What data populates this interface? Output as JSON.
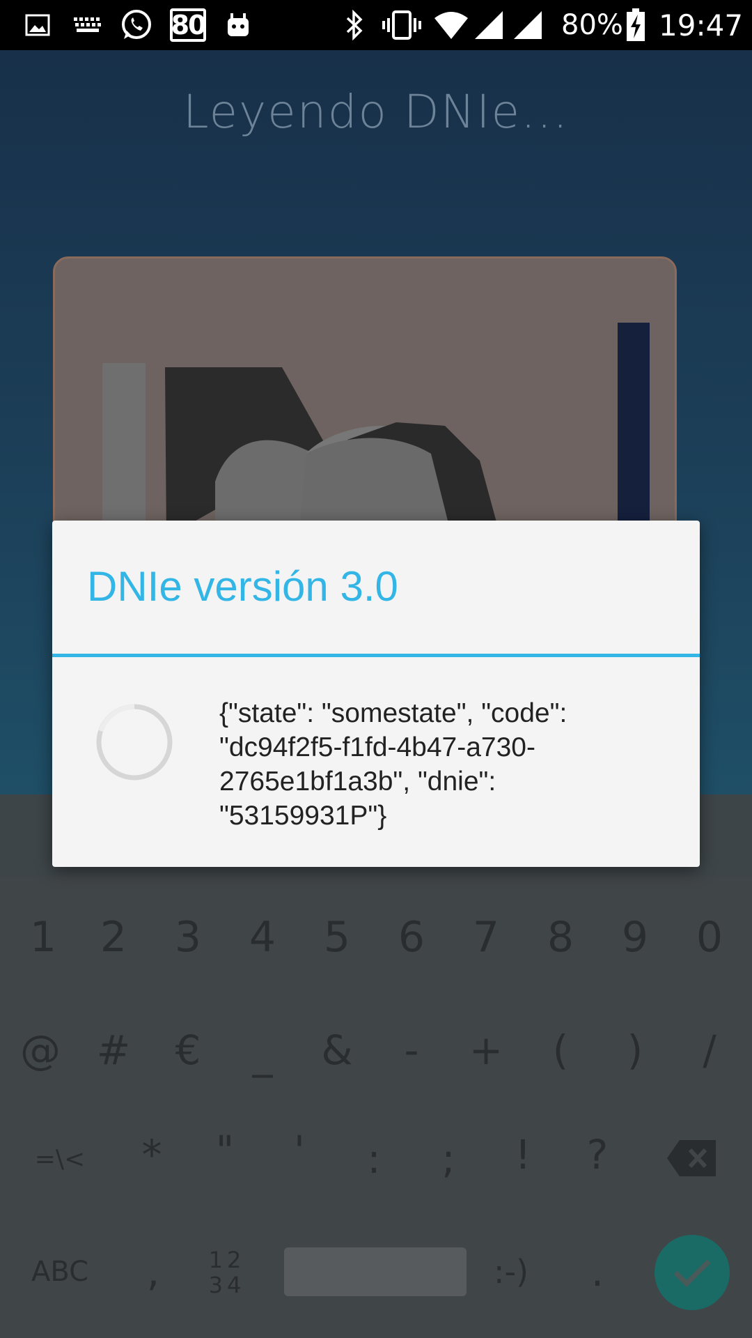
{
  "status_bar": {
    "notification_badge": "80",
    "battery_percent": "80%",
    "time": "19:47",
    "icons": [
      "image-icon",
      "keyboard-icon",
      "whatsapp-icon",
      "badge-icon",
      "android-icon",
      "bluetooth-icon",
      "vibrate-icon",
      "wifi-icon",
      "signal-icon",
      "signal-icon",
      "battery-charging-icon"
    ]
  },
  "app": {
    "title": "Leyendo DNIe..."
  },
  "dialog": {
    "title": "DNIe versión 3.0",
    "message": "{\"state\": \"somestate\", \"code\": \"dc94f2f5-f1fd-4b47-a730-2765e1bf1a3b\", \"dnie\": \"53159931P\"}",
    "accent_color": "#33b5e5"
  },
  "keyboard": {
    "row1": [
      "1",
      "2",
      "3",
      "4",
      "5",
      "6",
      "7",
      "8",
      "9",
      "0"
    ],
    "row2": [
      "@",
      "#",
      "€",
      "_",
      "&",
      "-",
      "+",
      "(",
      ")",
      "/"
    ],
    "row3": [
      "=\\<",
      "*",
      "\"",
      "'",
      ":",
      ";",
      "!",
      "?"
    ],
    "row4": {
      "abc": "ABC",
      "comma": ",",
      "numpad_top": "12",
      "numpad_bottom": "34",
      "emoticon": ":-)",
      "period": "."
    },
    "icons": [
      "backspace-icon",
      "check-icon"
    ]
  }
}
